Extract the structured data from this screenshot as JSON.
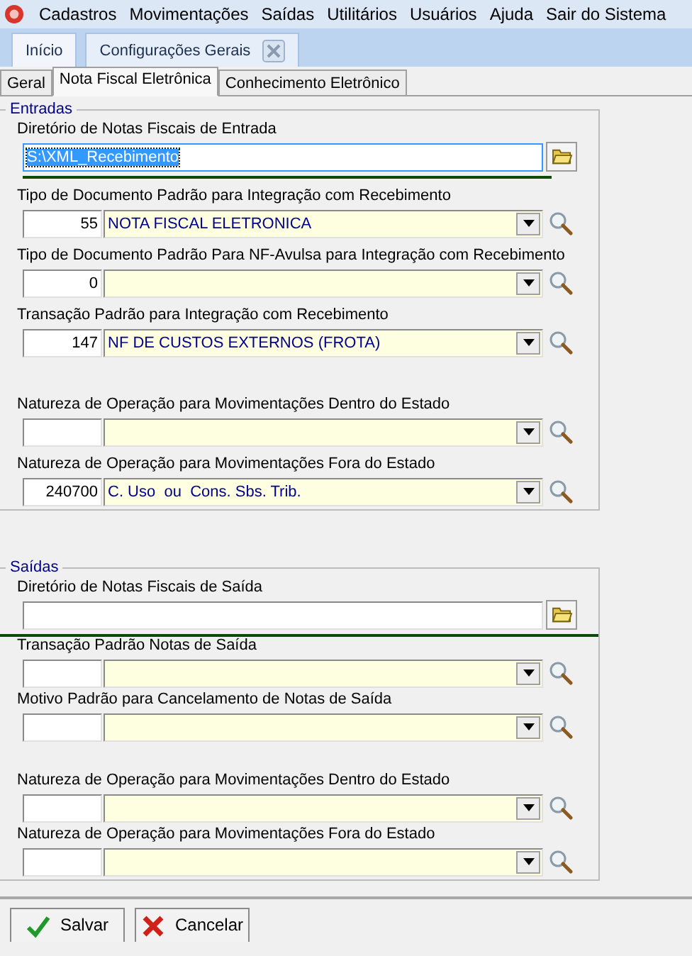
{
  "menu": [
    {
      "label": "Cadastros"
    },
    {
      "label": "Movimentações"
    },
    {
      "label": "Saídas"
    },
    {
      "label": "Utilitários"
    },
    {
      "label": "Usuários"
    },
    {
      "label": "Ajuda"
    },
    {
      "label": "Sair do Sistema"
    }
  ],
  "doc_tabs": [
    {
      "label": "Início",
      "selected": false,
      "closable": false
    },
    {
      "label": "Configurações Gerais",
      "selected": true,
      "closable": true
    }
  ],
  "sub_tabs": [
    {
      "label": "Geral",
      "selected": false
    },
    {
      "label": "Nota Fiscal Eletrônica",
      "selected": true
    },
    {
      "label": "Conhecimento Eletrônico",
      "selected": false
    }
  ],
  "sections": [
    {
      "title": "Entradas",
      "groups": [
        [
          {
            "kind": "directory",
            "label": "Diretório de Notas Fiscais de Entrada",
            "value": "S:\\XML_Recebimento",
            "highlighted": true
          },
          {
            "kind": "lookup",
            "label": "Tipo de Documento Padrão para Integração com Recebimento",
            "code": "55",
            "description": "NOTA FISCAL ELETRONICA"
          },
          {
            "kind": "lookup",
            "label": "Tipo de Documento Padrão Para NF-Avulsa para Integração com Recebimento",
            "code": "0"
          },
          {
            "kind": "lookup",
            "label": "Transação Padrão para Integração com Recebimento",
            "code": "147",
            "description": "NF DE CUSTOS EXTERNOS (FROTA)"
          }
        ],
        [
          {
            "kind": "lookup",
            "label": "Natureza de Operação para Movimentações Dentro do Estado"
          },
          {
            "kind": "lookup",
            "label": "Natureza de Operação para Movimentações Fora do Estado",
            "code": "240700",
            "description": "C. Uso  ou  Cons. Sbs. Trib."
          }
        ]
      ]
    },
    {
      "title": "Saídas",
      "groups": [
        [
          {
            "kind": "directory",
            "label": "Diretório de Notas Fiscais de Saída",
            "highlighted": false
          },
          {
            "kind": "lookup",
            "label": "Transação Padrão  Notas de Saída"
          },
          {
            "kind": "lookup",
            "label": "Motivo Padrão para Cancelamento de Notas de Saída"
          }
        ],
        [
          {
            "kind": "lookup",
            "label": "Natureza de Operação para Movimentações Dentro do Estado"
          },
          {
            "kind": "lookup",
            "label": "Natureza de Operação para Movimentações Fora do Estado"
          }
        ]
      ]
    }
  ],
  "buttons": [
    {
      "kind": "save",
      "label": "Salvar"
    },
    {
      "kind": "cancel",
      "label": "Cancelar"
    }
  ]
}
